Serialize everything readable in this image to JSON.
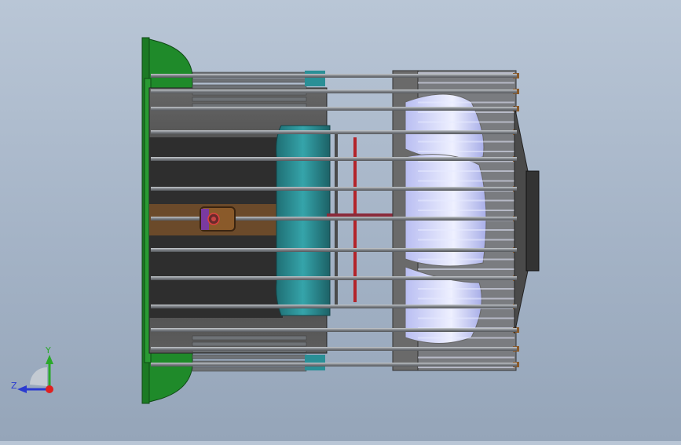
{
  "viewport": {
    "colors": {
      "background_top": "#b9c6d6",
      "background_bottom": "#95a5b9",
      "green_flange": "#1f8a2a",
      "teal_cooling": "#2a8f96",
      "housing_dark": "#3c3c3c",
      "housing_mid": "#5a5a5a",
      "rod": "#8c9094",
      "fan_blade": "#dfe3ff",
      "terminal": "#8a5a2a",
      "accent_red": "#b3242a"
    }
  },
  "triad": {
    "y_label": "Y",
    "z_label": "Z",
    "icon": "coordinate-triad-icon"
  }
}
